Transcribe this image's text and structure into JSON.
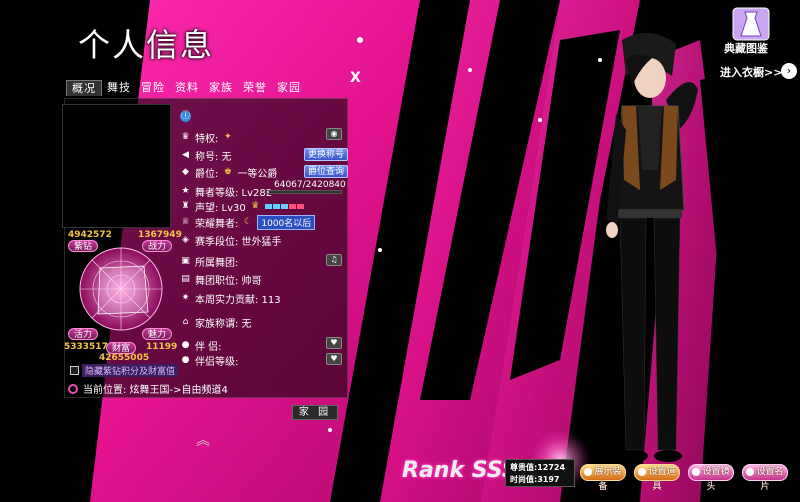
{
  "title": "个人信息",
  "tabs": [
    {
      "label": "概况",
      "active": true
    },
    {
      "label": "舞技",
      "active": false
    },
    {
      "label": "冒险",
      "active": false
    },
    {
      "label": "资料",
      "active": false
    },
    {
      "label": "家族",
      "active": false
    },
    {
      "label": "荣誉",
      "active": false
    },
    {
      "label": "家园",
      "active": false
    }
  ],
  "close_label": "X",
  "left": {
    "purple_diamond_value": "4942572",
    "purple_diamond_label": "紫钻",
    "power_value": "1367949",
    "power_label": "战力",
    "vitality_label": "活力",
    "vitality_value": "5333517",
    "wealth_label": "财富",
    "wealth_value": "42655005",
    "charm_label": "魅力",
    "charm_value": "11199",
    "hide_label": "隐藏紫钻积分及财富值",
    "location": "当前位置: 炫舞王国->自由频道4"
  },
  "info": {
    "privilege_label": "特权:",
    "title_label": "称号: 无",
    "change_title_btn": "更换称号",
    "nobility_label": "爵位:",
    "nobility_value": "一等公爵",
    "nobility_query_btn": "爵位查询",
    "dancer_level": "舞者等级: Lv282",
    "exp_text": "64067/2420840",
    "exp_fraction": 0.026,
    "reputation": "声望: Lv30",
    "glory_label": "荣耀舞者:",
    "glory_badge": "1000名以后",
    "season_rank": "赛季段位: 世外猛手",
    "troupe_label": "所属舞团:",
    "troupe_role": "舞团职位: 帅哥",
    "weekly_contribution": "本周实力贡献: 113",
    "family_title": "家族称谓: 无",
    "partner_label": "伴 侣:",
    "couple_level": "伴侣等级:",
    "home_btn": "家 园"
  },
  "right": {
    "collection_label": "典藏图鉴",
    "wardrobe_link": "进入衣橱>>"
  },
  "bottom": {
    "rank": "Rank SSS",
    "contribution": "尊贵值:12724",
    "duration": "时尚值:3197",
    "btn1": "展示装备",
    "btn2": "设置道具",
    "btn3": "设置镜头",
    "btn4": "设置名片"
  },
  "colors": {
    "accent_pink": "#e8169a",
    "gold": "#f4c44a",
    "blue_button": "#4a66d9"
  }
}
